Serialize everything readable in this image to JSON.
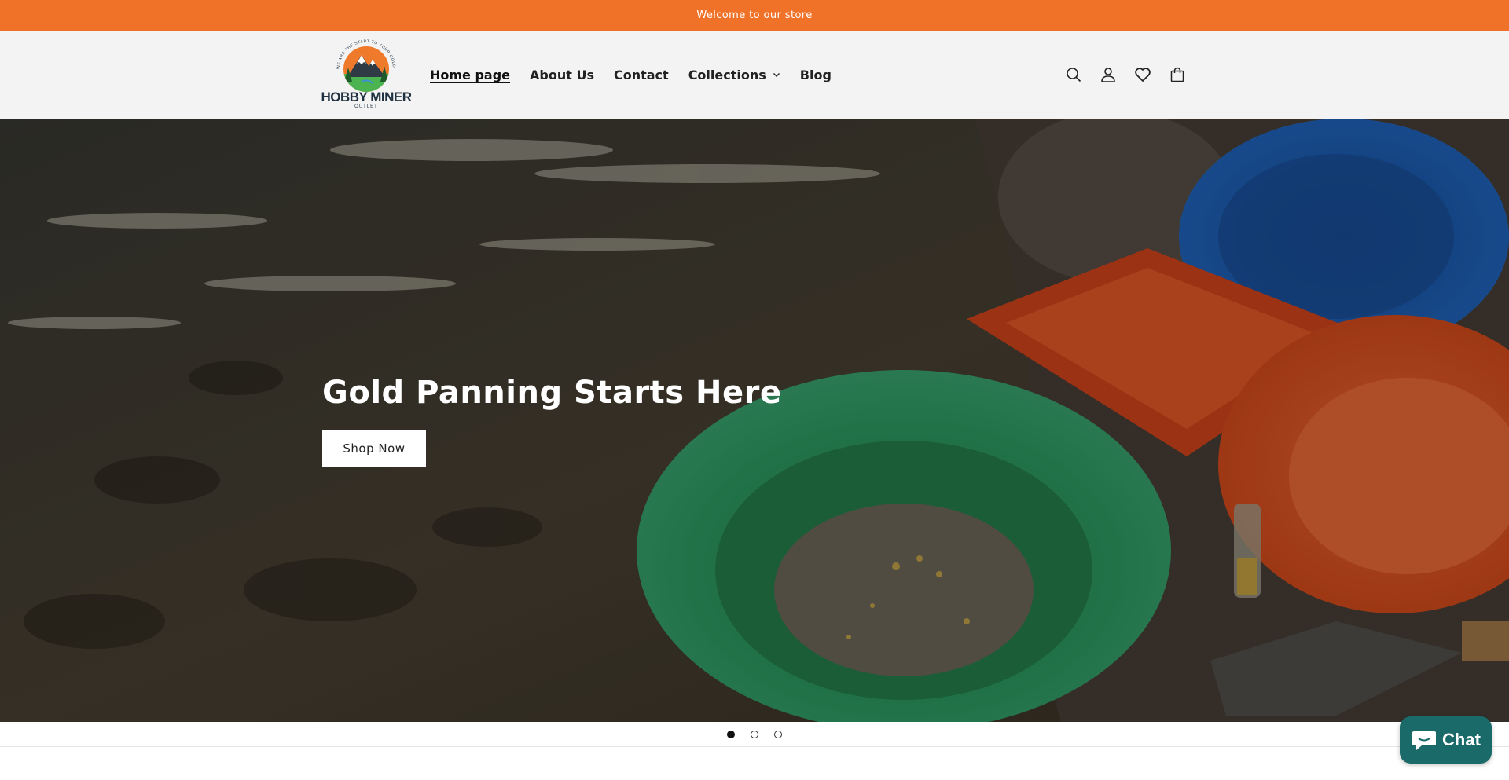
{
  "announcement": {
    "text": "Welcome to our store"
  },
  "logo": {
    "name": "HOBBY MINER",
    "sub": "OUTLET",
    "arc_text": "WE ARE THE START TO YOUR GOLDEN DREAMS"
  },
  "nav": {
    "items": [
      {
        "label": "Home page",
        "active": true
      },
      {
        "label": "About Us"
      },
      {
        "label": "Contact"
      },
      {
        "label": "Collections",
        "has_dropdown": true
      },
      {
        "label": "Blog"
      }
    ]
  },
  "header_icons": [
    "search-icon",
    "account-icon",
    "wishlist-heart-icon",
    "cart-icon"
  ],
  "hero": {
    "title": "Gold Panning Starts Here",
    "button_label": "Shop Now"
  },
  "slideshow": {
    "total": 3,
    "current": 1
  },
  "chat": {
    "label": "Chat"
  },
  "colors": {
    "announcement_bg": "#ef7228",
    "header_bg": "#f3f3f3",
    "chat_bg": "#1a6a6a",
    "pan_green": "#2e9e66",
    "pan_orange": "#e8531f",
    "pan_blue": "#1d5fb8"
  }
}
